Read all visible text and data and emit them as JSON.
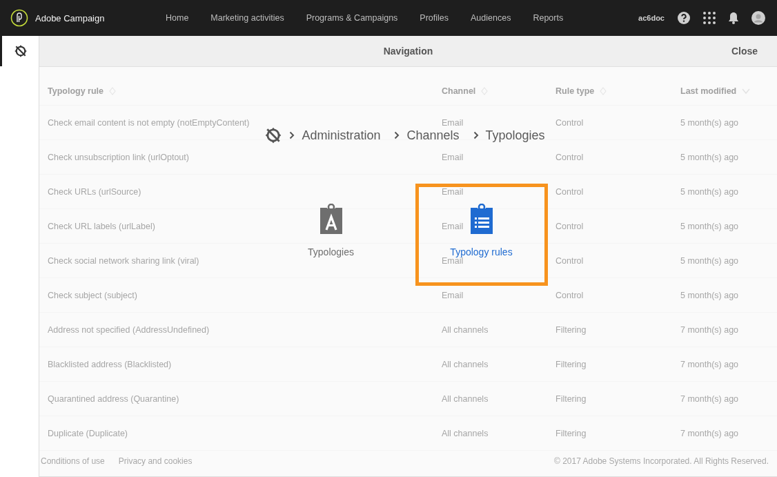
{
  "app": {
    "name": "Adobe Campaign"
  },
  "nav": [
    {
      "label": "Home"
    },
    {
      "label": "Marketing activities"
    },
    {
      "label": "Programs & Campaigns"
    },
    {
      "label": "Profiles"
    },
    {
      "label": "Audiences"
    },
    {
      "label": "Reports"
    }
  ],
  "user": {
    "name": "ac6doc"
  },
  "sidebar": {
    "items": [
      {
        "selected": true
      }
    ]
  },
  "dialog": {
    "title": "Navigation",
    "close": "Close",
    "breadcrumb": [
      "Administration",
      "Channels",
      "Typologies"
    ],
    "tiles": [
      {
        "label": "Typologies",
        "kind": "typology",
        "selected": false
      },
      {
        "label": "Typology rules",
        "kind": "rules",
        "selected": true
      }
    ]
  },
  "table": {
    "columns": [
      {
        "label": "Typology rule",
        "sorted": false
      },
      {
        "label": "Channel",
        "sorted": false
      },
      {
        "label": "Rule type",
        "sorted": false
      },
      {
        "label": "Last modified",
        "sorted": true
      }
    ],
    "rows": [
      [
        "Check email content is not empty (notEmptyContent)",
        "Email",
        "Control",
        "5 month(s) ago"
      ],
      [
        "Check unsubscription link (urlOptout)",
        "Email",
        "Control",
        "5 month(s) ago"
      ],
      [
        "Check URLs (urlSource)",
        "Email",
        "Control",
        "5 month(s) ago"
      ],
      [
        "Check URL labels (urlLabel)",
        "Email",
        "Control",
        "5 month(s) ago"
      ],
      [
        "Check social network sharing link (viral)",
        "Email",
        "Control",
        "5 month(s) ago"
      ],
      [
        "Check subject (subject)",
        "Email",
        "Control",
        "5 month(s) ago"
      ],
      [
        "Address not specified (AddressUndefined)",
        "All channels",
        "Filtering",
        "7 month(s) ago"
      ],
      [
        "Blacklisted address (Blacklisted)",
        "All channels",
        "Filtering",
        "7 month(s) ago"
      ],
      [
        "Quarantined address (Quarantine)",
        "All channels",
        "Filtering",
        "7 month(s) ago"
      ],
      [
        "Duplicate (Duplicate)",
        "All channels",
        "Filtering",
        "7 month(s) ago"
      ]
    ]
  },
  "footer": {
    "links": [
      "Conditions of use",
      "Privacy and cookies"
    ],
    "copyright": "© 2017 Adobe Systems Incorporated. All Rights Reserved."
  }
}
